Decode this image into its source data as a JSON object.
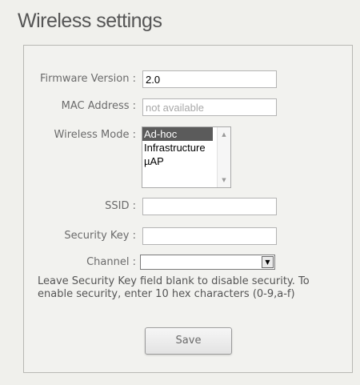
{
  "page": {
    "title": "Wireless settings"
  },
  "form": {
    "firmware": {
      "label": "Firmware Version :",
      "value": "2.0"
    },
    "mac": {
      "label": "MAC Address :",
      "value": "not available"
    },
    "wireless_mode": {
      "label": "Wireless Mode :",
      "options": [
        "Ad-hoc",
        "Infrastructure",
        "µAP"
      ],
      "selected": "Ad-hoc"
    },
    "ssid": {
      "label": "SSID :",
      "value": ""
    },
    "security_key": {
      "label": "Security Key :",
      "value": ""
    },
    "channel": {
      "label": "Channel :",
      "value": ""
    },
    "help_text": "Leave Security Key field blank to disable security. To enable security, enter 10 hex characters (0-9,a-f)",
    "save_label": "Save"
  },
  "colors": {
    "selected_option_bg": "#5b5b5b",
    "panel_border": "#b8b8b4",
    "page_bg": "#f0f0ec"
  }
}
